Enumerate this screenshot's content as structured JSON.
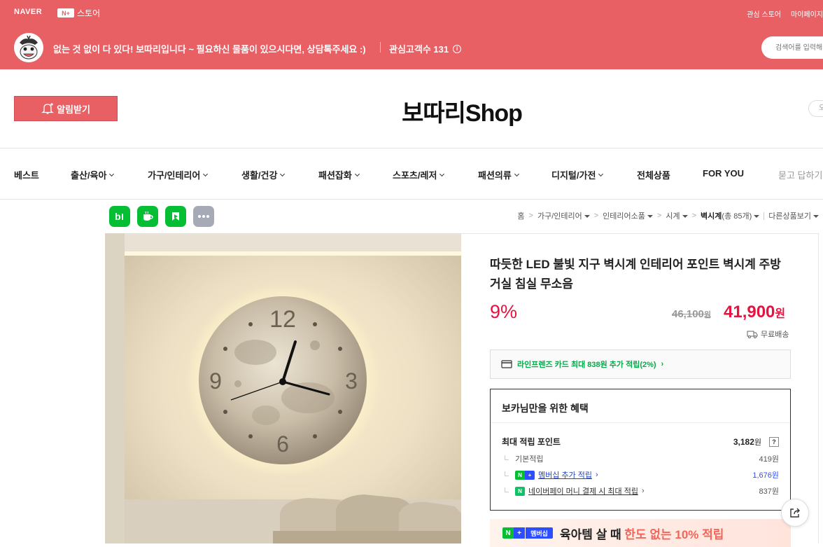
{
  "topbar": {
    "naver": "NAVER",
    "nplus_store": "스토어",
    "nplus_badge": "N+",
    "fav_store": "관심 스토어",
    "mypage": "마이페이지"
  },
  "store": {
    "intro": "없는 것 없이 다 있다! 보따리입니다 ~ 필요하신 물품이 있으시다면, 상담톡주세요 :)",
    "fav_count_label": "관심고객수 131",
    "search_placeholder": "검색어를 입력해",
    "alarm_label": "알림받기",
    "logo": "보따리Shop",
    "right_pill": "오"
  },
  "nav": [
    {
      "label": "베스트",
      "dropdown": false
    },
    {
      "label": "출산/육아",
      "dropdown": true
    },
    {
      "label": "가구/인테리어",
      "dropdown": true
    },
    {
      "label": "생활/건강",
      "dropdown": true
    },
    {
      "label": "패션잡화",
      "dropdown": true
    },
    {
      "label": "스포츠/레저",
      "dropdown": true
    },
    {
      "label": "패션의류",
      "dropdown": true
    },
    {
      "label": "디지털/가전",
      "dropdown": true
    },
    {
      "label": "전체상품",
      "dropdown": false
    },
    {
      "label": "FOR YOU",
      "dropdown": false
    },
    {
      "label": "묻고 답하기",
      "dropdown": false
    }
  ],
  "apps": [
    {
      "icon": "band-icon",
      "glyph": "b|",
      "color": "#06be34"
    },
    {
      "icon": "talk-icon",
      "glyph": "☕",
      "color": "#06be34"
    },
    {
      "icon": "blog-icon",
      "glyph": "▶",
      "color": "#06be34"
    },
    {
      "icon": "more-icon",
      "glyph": "•••",
      "color": "#a6aab7"
    }
  ],
  "breadcrumb": {
    "home": "홈",
    "c1": "가구/인테리어",
    "c2": "인테리어소품",
    "c3": "시계",
    "c4_name": "벽시계",
    "c4_count": "(총 85개)",
    "other": "다른상품보기"
  },
  "product": {
    "title": "따듯한 LED 불빛 지구 벽시계 인테리어 포인트 벽시계 주방 거실 침실 무소음",
    "discount": "9%",
    "original_price": "46,100",
    "original_unit": "원",
    "price": "41,900",
    "price_unit": "원",
    "shipping": "무료배송",
    "card_benefit": "라인프렌즈 카드 최대 838원 추가 적립(2%)"
  },
  "benefit": {
    "title": "보카님만을 위한 혜택",
    "max_label": "최대 적립 포인트",
    "max_value": "3,182",
    "max_unit": "원",
    "help": "?",
    "basic_label": "기본적립",
    "basic_value": "419원",
    "membership_label": "멤버십 추가 적립",
    "membership_value": "1,676원",
    "npay_label": "네이버페이 머니 결제 시 최대 적립",
    "npay_value": "837원"
  },
  "promo": {
    "badge": "멤버십",
    "text1": "육아템 살 때",
    "text2": "한도 없는 10% 적립"
  },
  "clock": {
    "n12": "12",
    "n3": "3",
    "n6": "6",
    "n9": "9"
  },
  "colors": {
    "brand": "#e85f64",
    "price": "#e4133f",
    "naver_green": "#06be34",
    "nplus_blue": "#2d4eff"
  }
}
